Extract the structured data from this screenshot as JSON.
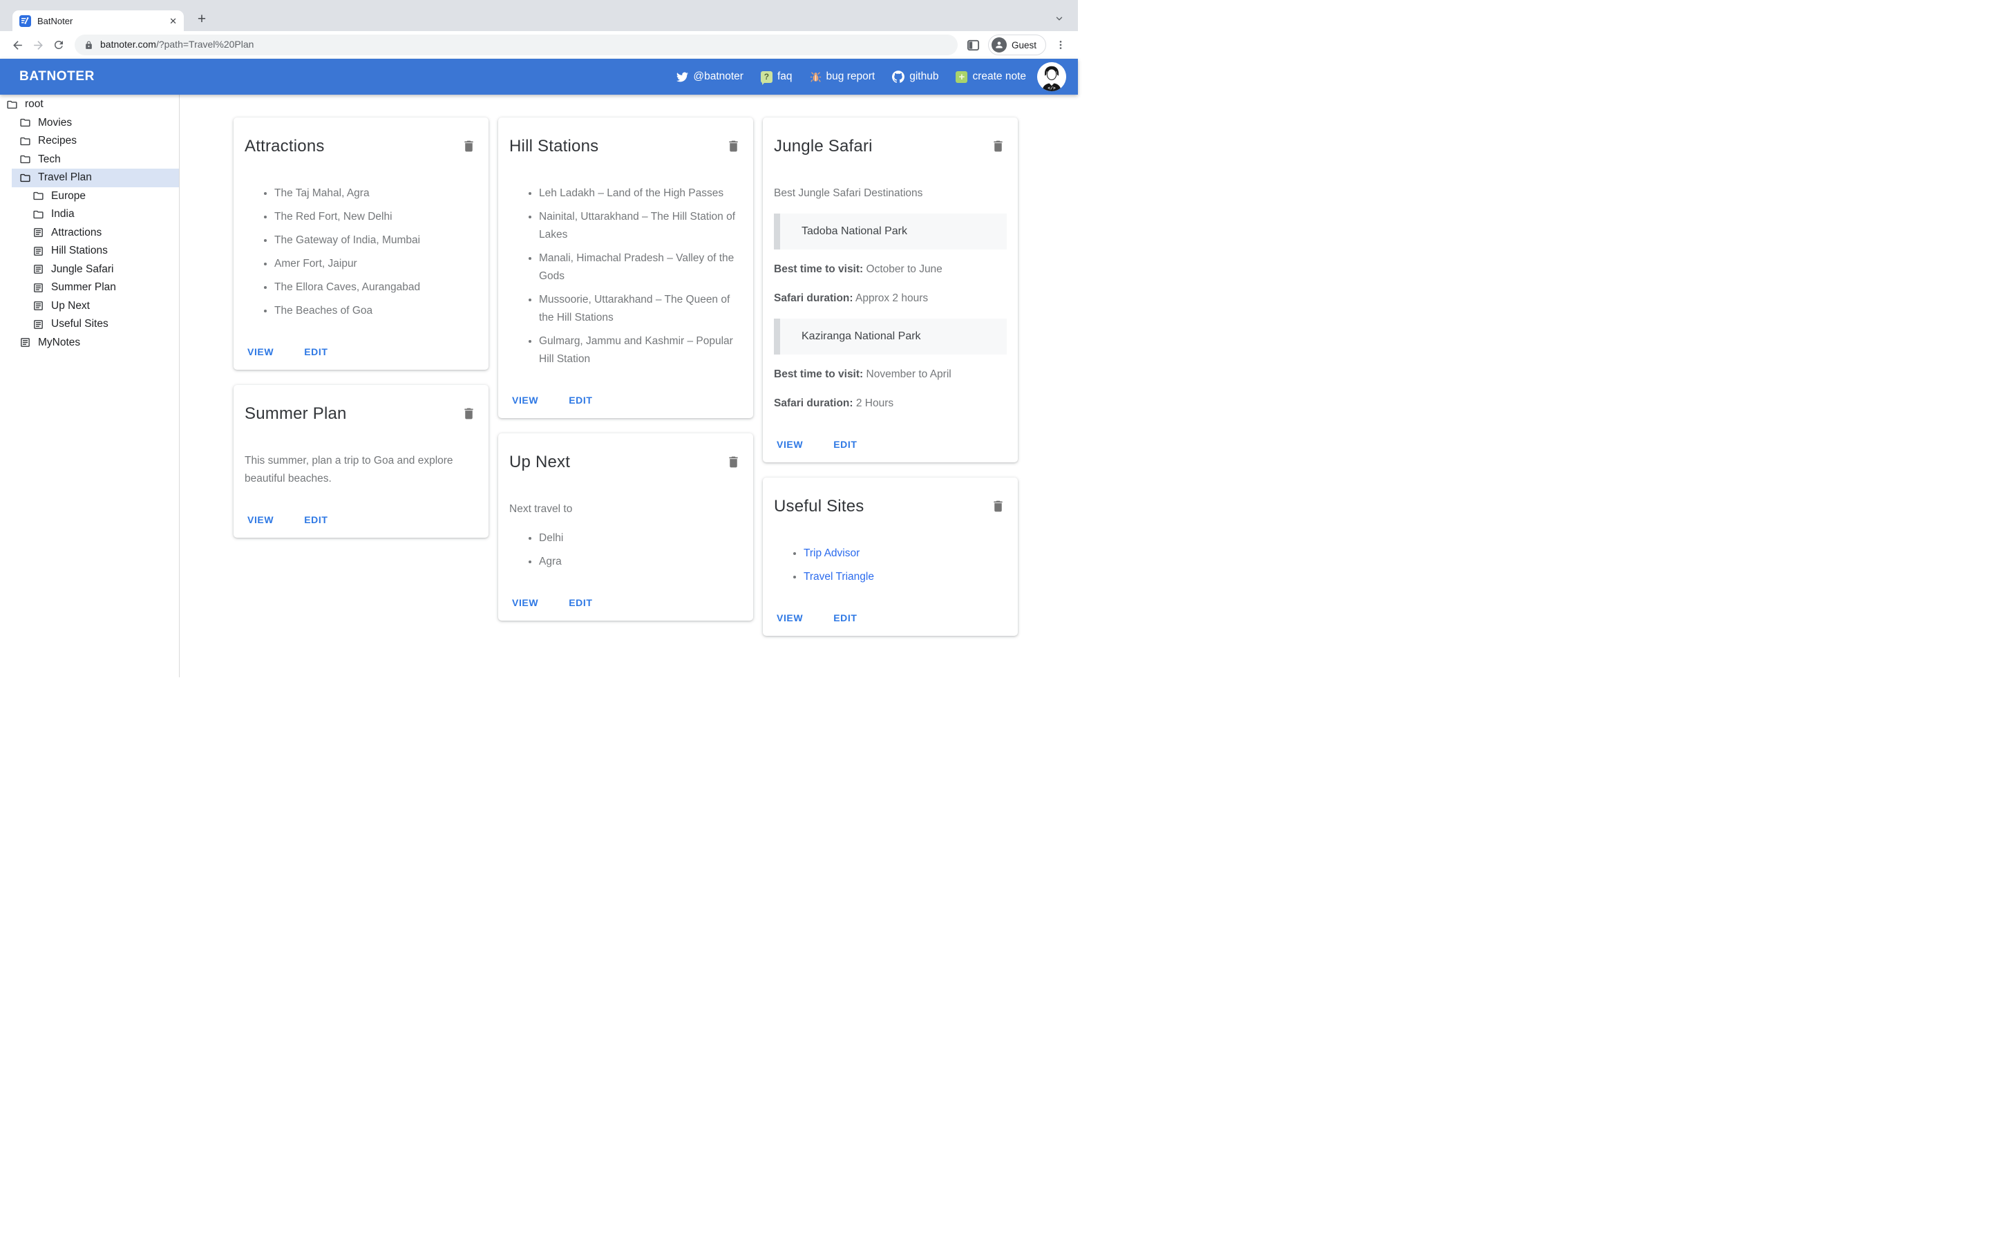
{
  "browser": {
    "tab_title": "BatNoter",
    "url_domain": "batnoter.com",
    "url_path": "/?path=Travel%20Plan",
    "guest_label": "Guest"
  },
  "glyphs": {
    "close": "✕",
    "plus": "+",
    "question": "?"
  },
  "header": {
    "brand": "BATNOTER",
    "nav_twitter": "@batnoter",
    "nav_faq": "faq",
    "nav_bug": "bug report",
    "nav_github": "github",
    "nav_create": "create note"
  },
  "sidebar": {
    "tree": [
      {
        "label": "root",
        "type": "folder",
        "level": 0,
        "selected": false
      },
      {
        "label": "Movies",
        "type": "folder",
        "level": 1,
        "selected": false
      },
      {
        "label": "Recipes",
        "type": "folder",
        "level": 1,
        "selected": false
      },
      {
        "label": "Tech",
        "type": "folder",
        "level": 1,
        "selected": false
      },
      {
        "label": "Travel Plan",
        "type": "folder",
        "level": 1,
        "selected": true
      },
      {
        "label": "Europe",
        "type": "folder",
        "level": 2,
        "selected": false
      },
      {
        "label": "India",
        "type": "folder",
        "level": 2,
        "selected": false
      },
      {
        "label": "Attractions",
        "type": "note",
        "level": 2,
        "selected": false
      },
      {
        "label": "Hill Stations",
        "type": "note",
        "level": 2,
        "selected": false
      },
      {
        "label": "Jungle Safari",
        "type": "note",
        "level": 2,
        "selected": false
      },
      {
        "label": "Summer Plan",
        "type": "note",
        "level": 2,
        "selected": false
      },
      {
        "label": "Up Next",
        "type": "note",
        "level": 2,
        "selected": false
      },
      {
        "label": "Useful Sites",
        "type": "note",
        "level": 2,
        "selected": false
      },
      {
        "label": "MyNotes",
        "type": "note",
        "level": 1,
        "selected": false
      }
    ]
  },
  "actions": {
    "view": "VIEW",
    "edit": "EDIT"
  },
  "cards": {
    "attractions": {
      "title": "Attractions",
      "items": [
        "The Taj Mahal, Agra",
        "The Red Fort, New Delhi",
        "The Gateway of India, Mumbai",
        "Amer Fort, Jaipur",
        "The Ellora Caves, Aurangabad",
        "The Beaches of Goa"
      ]
    },
    "hill_stations": {
      "title": "Hill Stations",
      "items": [
        "Leh Ladakh – Land of the High Passes",
        "Nainital, Uttarakhand – The Hill Station of Lakes",
        "Manali, Himachal Pradesh – Valley of the Gods",
        "Mussoorie, Uttarakhand – The Queen of the Hill Stations",
        "Gulmarg, Jammu and Kashmir – Popular Hill Station"
      ]
    },
    "jungle_safari": {
      "title": "Jungle Safari",
      "intro": "Best Jungle Safari Destinations",
      "quote1": "Tadoba National Park",
      "kv1_label": "Best time to visit:",
      "kv1_value": "October to June",
      "kv2_label": "Safari duration:",
      "kv2_value": "Approx 2 hours",
      "quote2": "Kaziranga National Park",
      "kv3_label": "Best time to visit:",
      "kv3_value": "November to April",
      "kv4_label": "Safari duration:",
      "kv4_value": "2 Hours"
    },
    "summer_plan": {
      "title": "Summer Plan",
      "body": "This summer, plan a trip to Goa and explore beautiful beaches."
    },
    "up_next": {
      "title": "Up Next",
      "intro": "Next travel to",
      "items": [
        "Delhi",
        "Agra"
      ]
    },
    "useful_sites": {
      "title": "Useful Sites",
      "links": [
        "Trip Advisor",
        "Travel Triangle"
      ]
    }
  },
  "colors": {
    "appbar_blue": "#3b76d4",
    "selected_row": "#d9e3f4",
    "button_blue": "#2e78e4",
    "link_blue": "#2b6bed",
    "body_gray": "#75787b",
    "quote_bg": "#f7f8f9",
    "quote_bar": "#d6d9dc"
  }
}
